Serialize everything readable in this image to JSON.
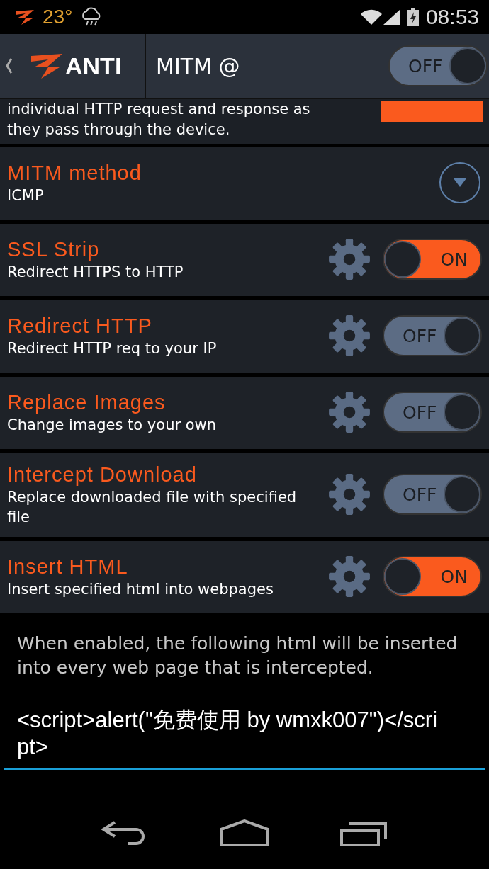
{
  "status_bar": {
    "temperature": "23°",
    "time": "08:53"
  },
  "action_bar": {
    "brand": "ANTI",
    "title": "MITM @",
    "toggle": {
      "label": "OFF",
      "on": false
    }
  },
  "intro": "individual HTTP request and response as they pass through the device.",
  "options": [
    {
      "kind": "dropdown",
      "title": "MITM method",
      "subtitle": "ICMP"
    },
    {
      "kind": "toggle",
      "title": "SSL Strip",
      "subtitle": "Redirect HTTPS to HTTP",
      "label": "ON",
      "on": true
    },
    {
      "kind": "toggle",
      "title": "Redirect HTTP",
      "subtitle": "Redirect HTTP req to your IP",
      "label": "OFF",
      "on": false
    },
    {
      "kind": "toggle",
      "title": "Replace Images",
      "subtitle": "Change images to your own",
      "label": "OFF",
      "on": false
    },
    {
      "kind": "toggle",
      "title": "Intercept Download",
      "subtitle": "Replace downloaded file with specified file",
      "label": "OFF",
      "on": false
    },
    {
      "kind": "toggle",
      "title": "Insert HTML",
      "subtitle": "Insert specified html into webpages",
      "label": "ON",
      "on": true
    }
  ],
  "html_section": {
    "description": "When enabled, the following html will be inserted into every web page that is intercepted.",
    "value": "<script>alert(\"免费使用 by wmxk007\")</script>"
  }
}
